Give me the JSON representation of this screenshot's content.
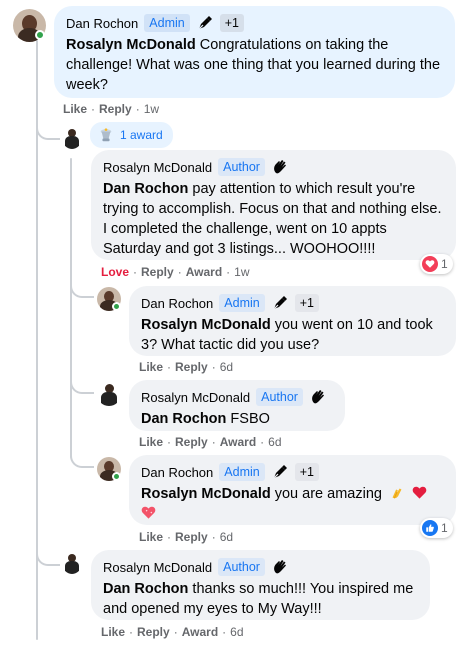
{
  "comments": [
    {
      "author": "Dan Rochon",
      "badge": "Admin",
      "extra_badges": "+1",
      "mention": "Rosalyn McDonald",
      "text": " Congratulations on taking the challenge! What was one thing that you learned during the week?",
      "actions": {
        "like": "Like",
        "reply": "Reply",
        "time": "1w"
      }
    },
    {
      "award": "1 award",
      "author": "Rosalyn McDonald",
      "badge": "Author",
      "mention": "Dan Rochon",
      "text": " pay attention to which result you're trying to accomplish. Focus on that and nothing else. I completed the challenge, went on 10 appts Saturday and got 3 listings... WOOHOO!!!!",
      "actions": {
        "like": "Love",
        "reply": "Reply",
        "award": "Award",
        "time": "1w"
      },
      "reaction_count": "1"
    },
    {
      "author": "Dan Rochon",
      "badge": "Admin",
      "extra_badges": "+1",
      "mention": "Rosalyn McDonald",
      "text": " you went on 10 and took 3? What tactic did you use?",
      "actions": {
        "like": "Like",
        "reply": "Reply",
        "time": "6d"
      }
    },
    {
      "author": "Rosalyn McDonald",
      "badge": "Author",
      "mention": "Dan Rochon",
      "text": " FSBO",
      "actions": {
        "like": "Like",
        "reply": "Reply",
        "award": "Award",
        "time": "6d"
      }
    },
    {
      "author": "Dan Rochon",
      "badge": "Admin",
      "extra_badges": "+1",
      "mention": "Rosalyn McDonald",
      "text": " you are amazing",
      "actions": {
        "like": "Like",
        "reply": "Reply",
        "time": "6d"
      },
      "reaction_count": "1"
    },
    {
      "author": "Rosalyn McDonald",
      "badge": "Author",
      "mention": "Dan Rochon",
      "text": " thanks so much!!! You inspired me and opened my eyes to My Way!!!",
      "actions": {
        "like": "Like",
        "reply": "Reply",
        "award": "Award",
        "time": "6d"
      }
    }
  ],
  "separator": "·",
  "icons": {
    "admin_badge": "pen-nib-icon",
    "author_badge": "waving-hand-icon",
    "award": "trophy-award-icon",
    "love_reaction": "heart-reaction-icon",
    "like_reaction": "thumbs-up-reaction-icon",
    "clap": "clapping-hands-emoji",
    "heart": "red-heart-emoji",
    "sparkle_heart": "sparkling-heart-emoji"
  },
  "colors": {
    "badge_blue": "#1876f2",
    "love_red": "#e41e3f",
    "online_green": "#31a24c",
    "like_blue": "#1877f2"
  }
}
